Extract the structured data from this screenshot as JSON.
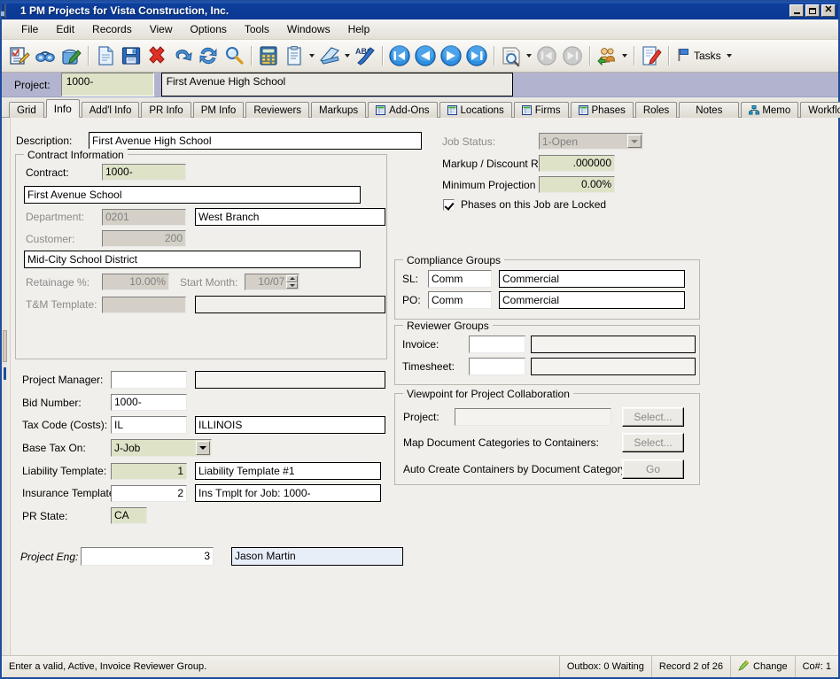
{
  "window": {
    "title": "1 PM Projects for Vista Construction, Inc.",
    "icon": "document-window-icon",
    "minimize": "–",
    "maximize": "□",
    "close": "✕"
  },
  "menu": {
    "items": [
      "File",
      "Edit",
      "Records",
      "View",
      "Options",
      "Tools",
      "Windows",
      "Help"
    ]
  },
  "toolbar": {
    "items": [
      {
        "name": "edit-form-icon"
      },
      {
        "name": "binoculars-find-icon"
      },
      {
        "name": "edit-record-icon"
      },
      {
        "name": "sep"
      },
      {
        "name": "new-document-icon"
      },
      {
        "name": "save-icon"
      },
      {
        "name": "delete-icon"
      },
      {
        "name": "undo-icon"
      },
      {
        "name": "refresh-icon"
      },
      {
        "name": "search-icon"
      },
      {
        "name": "sep"
      },
      {
        "name": "calculator-icon"
      },
      {
        "name": "clipboard-icon"
      },
      {
        "name": "attach-dropdown-caret"
      },
      {
        "name": "scanner-icon"
      },
      {
        "name": "scanner-dropdown-caret"
      },
      {
        "name": "spellcheck-icon"
      },
      {
        "name": "sep"
      },
      {
        "name": "first-record-icon"
      },
      {
        "name": "previous-record-icon"
      },
      {
        "name": "next-record-icon"
      },
      {
        "name": "last-record-icon"
      },
      {
        "name": "sep"
      },
      {
        "name": "preview-report-icon"
      },
      {
        "name": "preview-dropdown-caret"
      },
      {
        "name": "first-page-disabled-icon"
      },
      {
        "name": "last-page-disabled-icon"
      },
      {
        "name": "sep"
      },
      {
        "name": "contacts-icon"
      },
      {
        "name": "contacts-dropdown-caret"
      },
      {
        "name": "sep"
      },
      {
        "name": "notes-icon"
      },
      {
        "name": "sep"
      }
    ],
    "tasks_label": "Tasks",
    "tasks_icon": "flag-icon"
  },
  "project_bar": {
    "label": "Project:",
    "number": "1000-",
    "description": "First Avenue High School"
  },
  "tabs": [
    {
      "label": "Grid",
      "icon": null,
      "active": false
    },
    {
      "label": "Info",
      "icon": null,
      "active": true
    },
    {
      "label": "Add'l Info",
      "icon": null,
      "active": false
    },
    {
      "label": "PR Info",
      "icon": null,
      "active": false
    },
    {
      "label": "PM Info",
      "icon": null,
      "active": false
    },
    {
      "label": "Reviewers",
      "icon": null,
      "active": false
    },
    {
      "label": "Markups",
      "icon": null,
      "active": false
    },
    {
      "label": "Add-Ons",
      "icon": "grid-icon",
      "active": false
    },
    {
      "label": "Locations",
      "icon": "grid-icon",
      "active": false
    },
    {
      "label": "Firms",
      "icon": "grid-icon",
      "active": false
    },
    {
      "label": "Phases",
      "icon": "grid-icon",
      "active": false
    },
    {
      "label": "Roles",
      "icon": null,
      "active": false
    },
    {
      "label": "Notes",
      "icon": null,
      "active": false
    },
    {
      "label": "Memo",
      "icon": "hierarchy-icon",
      "active": false
    },
    {
      "label": "Workflow",
      "icon": null,
      "active": false
    }
  ],
  "form": {
    "description_label": "Description:",
    "description_value": "First Avenue High School",
    "contract_group": {
      "caption": "Contract Information",
      "contract_label": "Contract:",
      "contract_value": "1000-",
      "contract_desc": "First Avenue School",
      "department_label": "Department:",
      "department_value": "0201",
      "department_desc": "West Branch",
      "customer_label": "Customer:",
      "customer_value": "200",
      "customer_desc": "Mid-City School District",
      "retainage_label": "Retainage %:",
      "retainage_value": "10.00%",
      "start_month_label": "Start Month:",
      "start_month_value": "10/07",
      "tm_template_label": "T&M Template:",
      "tm_template_value": "",
      "tm_template_desc": ""
    },
    "project_manager_label": "Project Manager:",
    "project_manager_value": "",
    "project_manager_desc": "",
    "bid_number_label": "Bid Number:",
    "bid_number_value": "1000-",
    "tax_code_label": "Tax Code (Costs):",
    "tax_code_value": "IL",
    "tax_code_desc": "ILLINOIS",
    "base_tax_on_label": "Base Tax On:",
    "base_tax_on_value": "J-Job",
    "liability_template_label": "Liability Template:",
    "liability_template_value": "1",
    "liability_template_desc": "Liability Template #1",
    "insurance_template_label": "Insurance Template:",
    "insurance_template_value": "2",
    "insurance_template_desc": "Ins Tmplt for Job:  1000-",
    "pr_state_label": "PR State:",
    "pr_state_value": "CA",
    "project_eng_label": "Project Eng:",
    "project_eng_value": "3",
    "project_eng_desc": "Jason Martin"
  },
  "right": {
    "job_status_label": "Job Status:",
    "job_status_value": "1-Open",
    "markup_label": "Markup / Discount Rate:",
    "markup_value": ".000000",
    "min_projection_label": "Minimum Projection %:",
    "min_projection_value": "0.00%",
    "phases_locked_label": "Phases on this Job are Locked",
    "phases_locked_checked": true,
    "compliance_group": {
      "caption": "Compliance Groups",
      "sl_label": "SL:",
      "sl_value": "Comm",
      "sl_desc": "Commercial",
      "po_label": "PO:",
      "po_value": "Comm",
      "po_desc": "Commercial"
    },
    "reviewer_group": {
      "caption": "Reviewer Groups",
      "invoice_label": "Invoice:",
      "invoice_value": "",
      "invoice_desc": "",
      "timesheet_label": "Timesheet:",
      "timesheet_value": "",
      "timesheet_desc": ""
    },
    "viewpoint_group": {
      "caption": "Viewpoint for Project Collaboration",
      "project_label": "Project:",
      "project_value": "",
      "project_button": "Select...",
      "map_label": "Map Document Categories to Containers:",
      "map_button": "Select...",
      "auto_label": "Auto Create Containers by Document Category:",
      "auto_button": "Go"
    }
  },
  "status_bar": {
    "message": "Enter a valid, Active, Invoice Reviewer Group.",
    "outbox": "Outbox: 0 Waiting",
    "record": "Record 2 of 26",
    "mode": "Change",
    "mode_icon": "pencil-icon",
    "company": "Co#: 1"
  },
  "colors": {
    "title_bar": "#0a3a95",
    "project_band": "#b2b4cf",
    "required_field": "#dee3c7",
    "disabled_field": "#d4d0c8",
    "readonly_blue": "#e8eef8",
    "form_bg": "#f1efeb"
  }
}
